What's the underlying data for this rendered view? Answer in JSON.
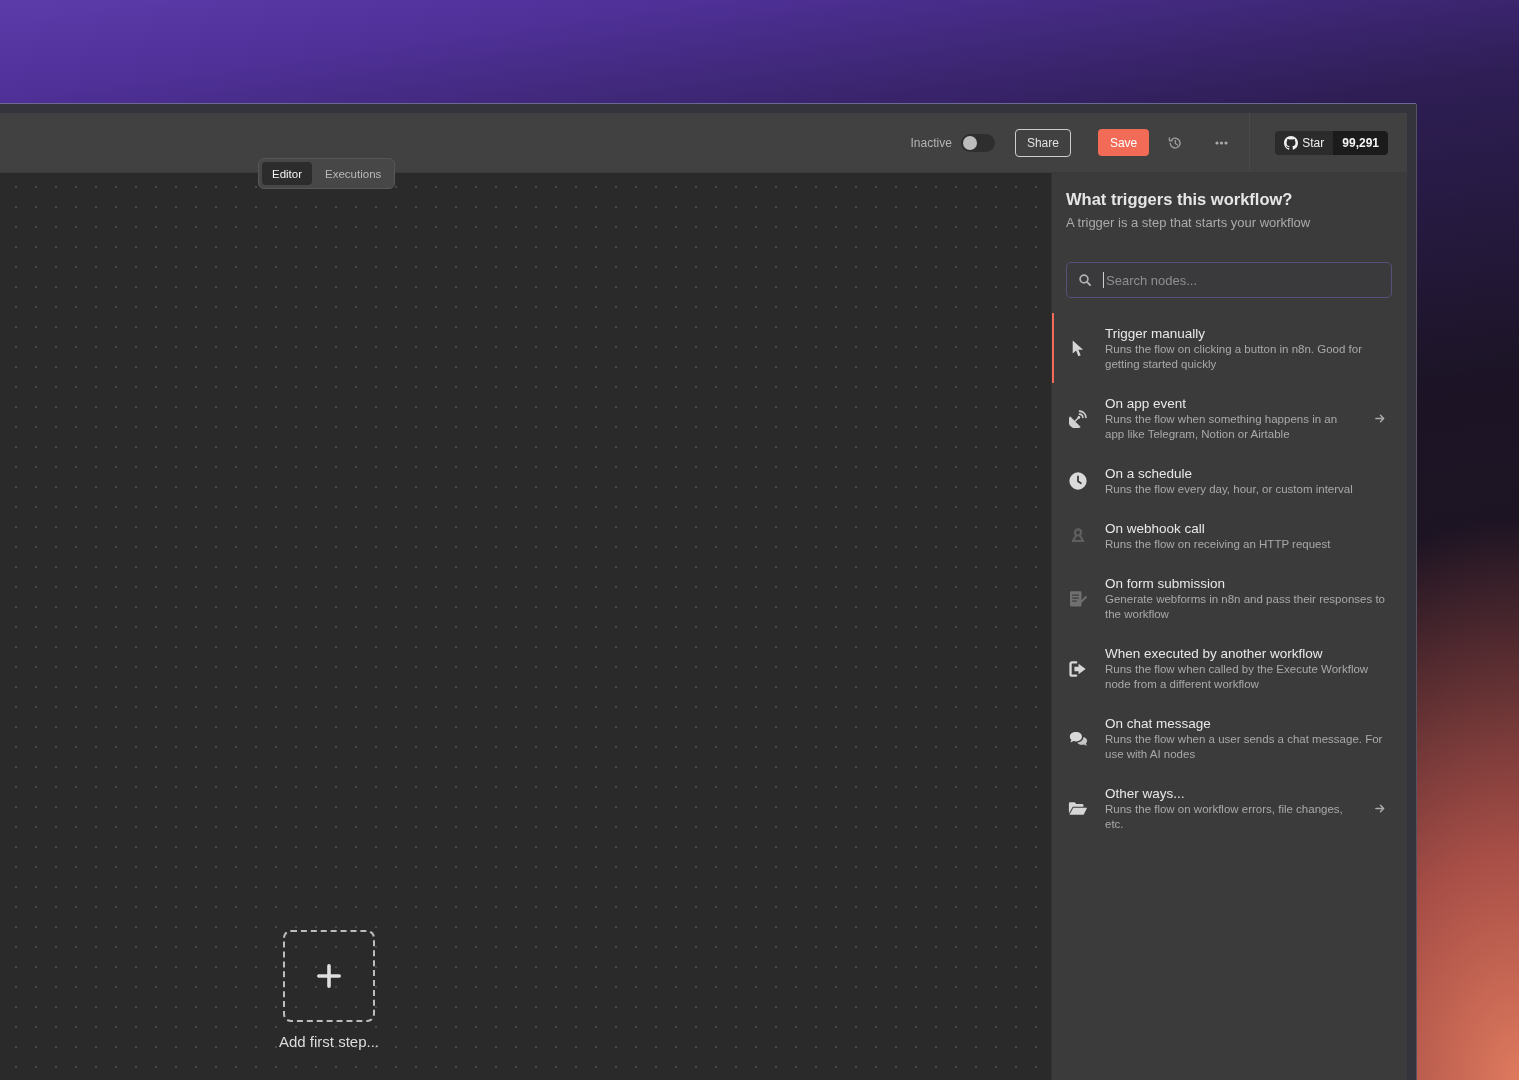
{
  "header": {
    "status_label": "Inactive",
    "active": false,
    "share_button": "Share",
    "save_button": "Save",
    "github": {
      "label": "Star",
      "count": "99,291"
    }
  },
  "view_tabs": [
    {
      "label": "Editor",
      "selected": true
    },
    {
      "label": "Executions",
      "selected": false
    }
  ],
  "canvas": {
    "add_step_label": "Add first step..."
  },
  "trigger_panel": {
    "title": "What triggers this workflow?",
    "subtitle": "A trigger is a step that starts your workflow",
    "search": {
      "placeholder": "Search nodes...",
      "focused": true
    },
    "items": [
      {
        "title": "Trigger manually",
        "description": "Runs the flow on clicking a button in n8n. Good for getting started quickly",
        "selected": true,
        "submenu": false
      },
      {
        "title": "On app event",
        "description": "Runs the flow when something happens in an app like Telegram, Notion or Airtable",
        "selected": false,
        "submenu": true
      },
      {
        "title": "On a schedule",
        "description": "Runs the flow every day, hour, or custom interval",
        "selected": false,
        "submenu": false
      },
      {
        "title": "On webhook call",
        "description": "Runs the flow on receiving an HTTP request",
        "selected": false,
        "submenu": false
      },
      {
        "title": "On form submission",
        "description": "Generate webforms in n8n and pass their responses to the workflow",
        "selected": false,
        "submenu": false
      },
      {
        "title": "When executed by another workflow",
        "description": "Runs the flow when called by the Execute Workflow node from a different workflow",
        "selected": false,
        "submenu": false
      },
      {
        "title": "On chat message",
        "description": "Runs the flow when a user sends a chat message. For use with AI nodes",
        "selected": false,
        "submenu": false
      },
      {
        "title": "Other ways...",
        "description": "Runs the flow on workflow errors, file changes, etc.",
        "selected": false,
        "submenu": true
      }
    ]
  }
}
